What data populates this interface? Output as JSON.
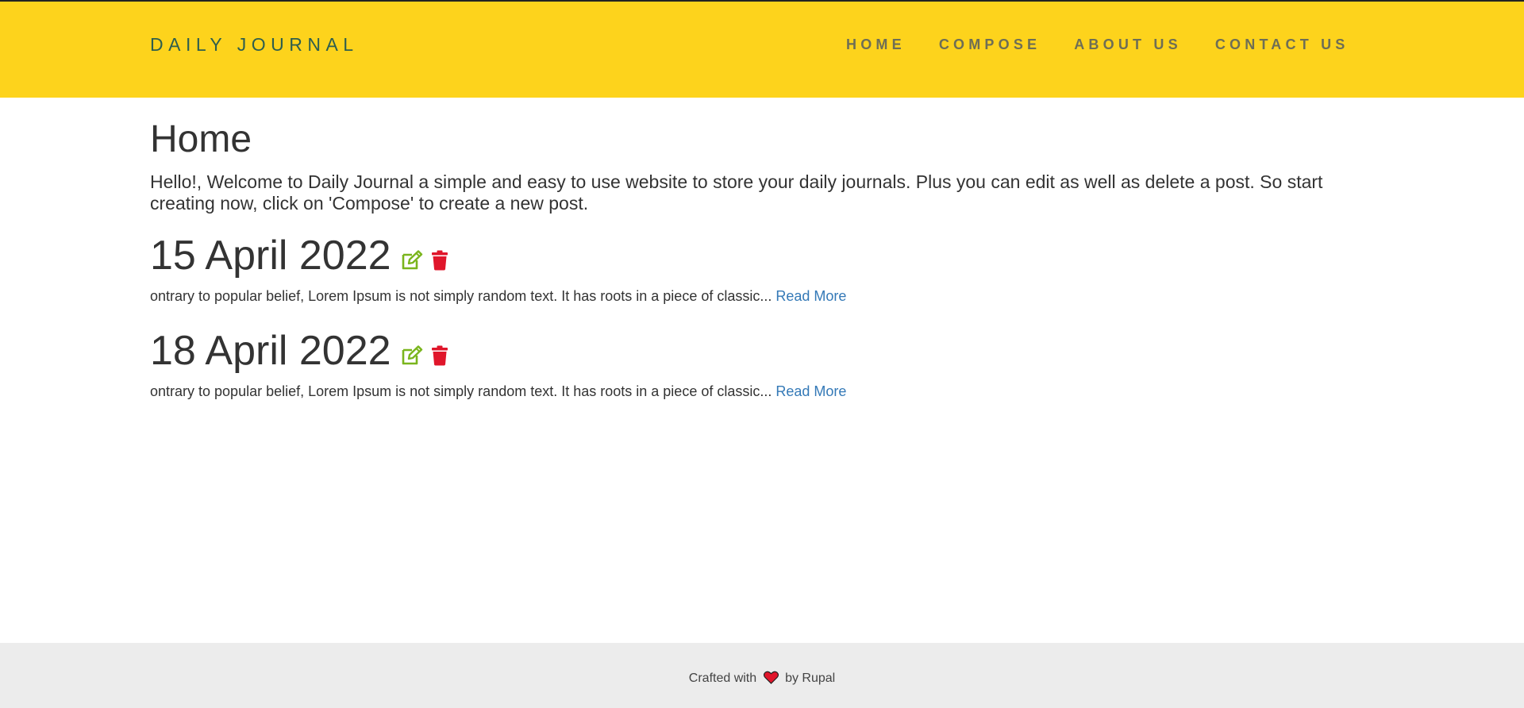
{
  "header": {
    "brand": "DAILY JOURNAL",
    "nav": [
      {
        "label": "HOME"
      },
      {
        "label": "COMPOSE"
      },
      {
        "label": "ABOUT US"
      },
      {
        "label": "CONTACT US"
      }
    ]
  },
  "main": {
    "title": "Home",
    "intro": "Hello!, Welcome to Daily Journal a simple and easy to use website to store your daily journals. Plus you can edit as well as delete a post. So start creating now, click on 'Compose' to create a new post.",
    "posts": [
      {
        "title": "15 April 2022",
        "excerpt": "ontrary to popular belief, Lorem Ipsum is not simply random text. It has roots in a piece of classic...",
        "read_more": "Read More",
        "edit_icon": "edit-icon",
        "delete_icon": "trash-icon"
      },
      {
        "title": "18 April 2022",
        "excerpt": "ontrary to popular belief, Lorem Ipsum is not simply random text. It has roots in a piece of classic...",
        "read_more": "Read More",
        "edit_icon": "edit-icon",
        "delete_icon": "trash-icon"
      }
    ]
  },
  "footer": {
    "prefix": "Crafted with",
    "suffix": "by Rupal",
    "heart_icon": "heart-icon"
  },
  "colors": {
    "navbar_bg": "#fdd31c",
    "brand": "#2e5e4e",
    "nav_link": "#6e6e55",
    "edit_icon": "#7ab51d",
    "delete_icon": "#e0162b",
    "link": "#3479b7",
    "footer_bg": "#ececec",
    "heart": "#e0162b"
  }
}
